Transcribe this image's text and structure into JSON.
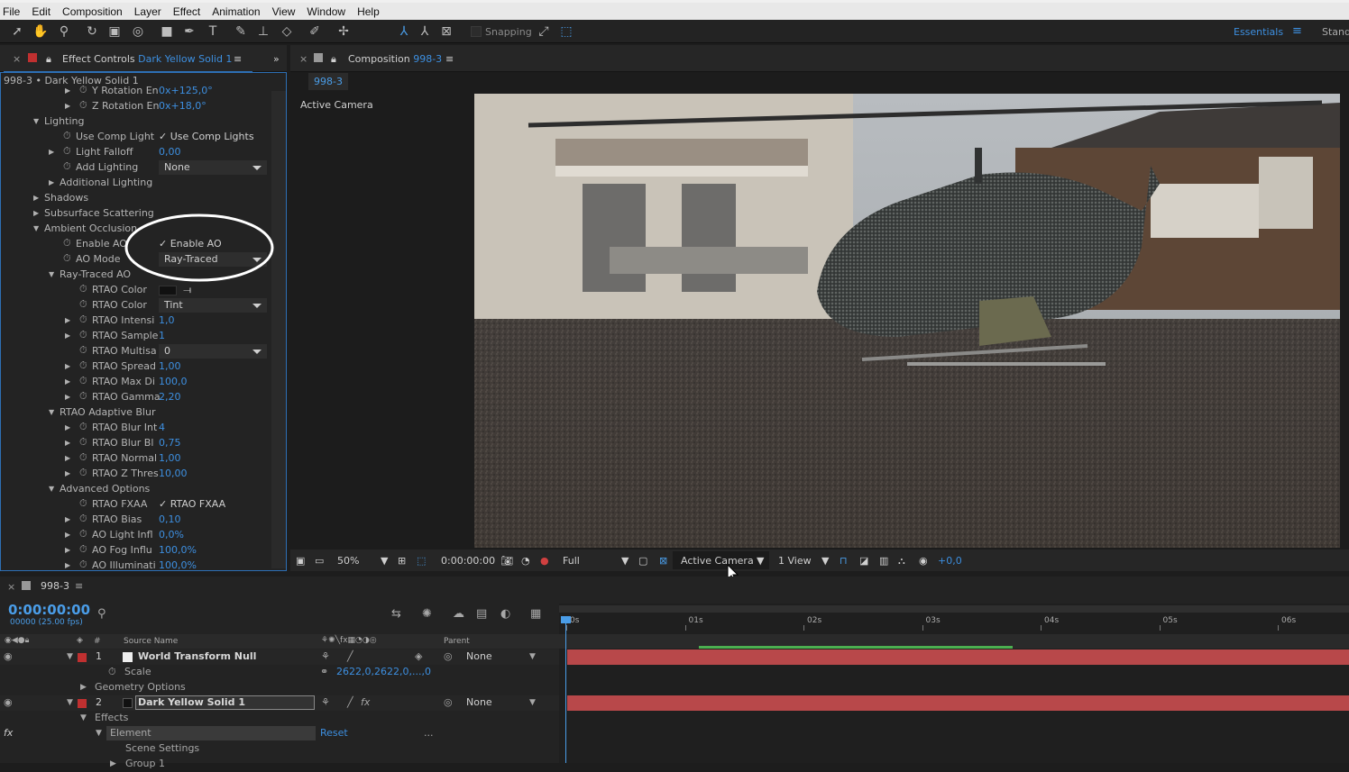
{
  "menu": [
    "File",
    "Edit",
    "Composition",
    "Layer",
    "Effect",
    "Animation",
    "View",
    "Window",
    "Help"
  ],
  "toolbar": {
    "snapping_label": "Snapping",
    "workspace_label": "Essentials",
    "workspace_other": "Stand"
  },
  "effect_panel": {
    "tab_label": "Effect Controls",
    "layer_name": "Dark Yellow Solid 1",
    "breadcrumb": "998-3 • Dark Yellow Solid 1",
    "rows": [
      {
        "indent": 2,
        "tri": "right",
        "sw": true,
        "name": "Y Rotation En",
        "value": "0x+125,0°",
        "type": "blue"
      },
      {
        "indent": 2,
        "tri": "right",
        "sw": true,
        "name": "Z Rotation En",
        "value": "0x+18,0°",
        "type": "blue"
      },
      {
        "indent": 0,
        "tri": "down",
        "sw": false,
        "name": "Lighting",
        "value": "",
        "type": ""
      },
      {
        "indent": 1,
        "tri": "",
        "sw": true,
        "name": "Use Comp Light",
        "value": "Use Comp Lights",
        "type": "check"
      },
      {
        "indent": 1,
        "tri": "right",
        "sw": true,
        "name": "Light Falloff",
        "value": "0,00",
        "type": "blue"
      },
      {
        "indent": 1,
        "tri": "",
        "sw": true,
        "name": "Add Lighting",
        "value": "None",
        "type": "dropdown"
      },
      {
        "indent": 1,
        "tri": "right",
        "sw": false,
        "name": "Additional Lighting",
        "value": "",
        "type": ""
      },
      {
        "indent": 0,
        "tri": "right",
        "sw": false,
        "name": "Shadows",
        "value": "",
        "type": ""
      },
      {
        "indent": 0,
        "tri": "right",
        "sw": false,
        "name": "Subsurface Scattering",
        "value": "",
        "type": ""
      },
      {
        "indent": 0,
        "tri": "down",
        "sw": false,
        "name": "Ambient Occlusion",
        "value": "",
        "type": ""
      },
      {
        "indent": 1,
        "tri": "",
        "sw": true,
        "name": "Enable AO",
        "value": "Enable AO",
        "type": "check"
      },
      {
        "indent": 1,
        "tri": "",
        "sw": true,
        "name": "AO Mode",
        "value": "Ray-Traced",
        "type": "dropdown"
      },
      {
        "indent": 1,
        "tri": "down",
        "sw": false,
        "name": "Ray-Traced AO",
        "value": "",
        "type": ""
      },
      {
        "indent": 2,
        "tri": "",
        "sw": true,
        "name": "RTAO Color",
        "value": "",
        "type": "color"
      },
      {
        "indent": 2,
        "tri": "",
        "sw": true,
        "name": "RTAO Color",
        "value": "Tint",
        "type": "dropdown"
      },
      {
        "indent": 2,
        "tri": "right",
        "sw": true,
        "name": "RTAO Intensi",
        "value": "1,0",
        "type": "blue"
      },
      {
        "indent": 2,
        "tri": "right",
        "sw": true,
        "name": "RTAO Sample",
        "value": "1",
        "type": "blue"
      },
      {
        "indent": 2,
        "tri": "",
        "sw": true,
        "name": "RTAO Multisa",
        "value": "0",
        "type": "dropdown"
      },
      {
        "indent": 2,
        "tri": "right",
        "sw": true,
        "name": "RTAO Spread",
        "value": "1,00",
        "type": "blue"
      },
      {
        "indent": 2,
        "tri": "right",
        "sw": true,
        "name": "RTAO Max Di",
        "value": "100,0",
        "type": "blue"
      },
      {
        "indent": 2,
        "tri": "right",
        "sw": true,
        "name": "RTAO Gamma",
        "value": "2,20",
        "type": "blue"
      },
      {
        "indent": 1,
        "tri": "down",
        "sw": false,
        "name": "RTAO Adaptive Blur",
        "value": "",
        "type": ""
      },
      {
        "indent": 2,
        "tri": "right",
        "sw": true,
        "name": "RTAO Blur Int",
        "value": "4",
        "type": "blue"
      },
      {
        "indent": 2,
        "tri": "right",
        "sw": true,
        "name": "RTAO Blur Bl",
        "value": "0,75",
        "type": "blue"
      },
      {
        "indent": 2,
        "tri": "right",
        "sw": true,
        "name": "RTAO Normal",
        "value": "1,00",
        "type": "blue"
      },
      {
        "indent": 2,
        "tri": "right",
        "sw": true,
        "name": "RTAO Z Thres",
        "value": "10,00",
        "type": "blue"
      },
      {
        "indent": 1,
        "tri": "down",
        "sw": false,
        "name": "Advanced Options",
        "value": "",
        "type": ""
      },
      {
        "indent": 2,
        "tri": "",
        "sw": true,
        "name": "RTAO FXAA",
        "value": "RTAO FXAA",
        "type": "check"
      },
      {
        "indent": 2,
        "tri": "right",
        "sw": true,
        "name": "RTAO Bias",
        "value": "0,10",
        "type": "blue"
      },
      {
        "indent": 2,
        "tri": "right",
        "sw": true,
        "name": "AO Light Infl",
        "value": "0,0%",
        "type": "blue"
      },
      {
        "indent": 2,
        "tri": "right",
        "sw": true,
        "name": "AO Fog Influ",
        "value": "100,0%",
        "type": "blue"
      },
      {
        "indent": 2,
        "tri": "right",
        "sw": true,
        "name": "AO Illuminati",
        "value": "100,0%",
        "type": "blue"
      }
    ]
  },
  "composition": {
    "tab_label": "Composition",
    "comp_name": "998-3",
    "subtab": "998-3",
    "view_label": "Active Camera",
    "bottom": {
      "zoom": "50%",
      "timecode": "0:00:00:00",
      "resolution": "Full",
      "camera": "Active Camera",
      "views": "1 View",
      "exposure": "+0,0"
    }
  },
  "timeline": {
    "tab_label": "998-3",
    "timecode": "0:00:00:00",
    "frame_info": "00000 (25.00 fps)",
    "col_hash": "#",
    "col_source": "Source Name",
    "col_parent": "Parent",
    "ruler": [
      "0s",
      "01s",
      "02s",
      "03s",
      "04s",
      "05s",
      "06s"
    ],
    "layers": [
      {
        "num": "1",
        "name": "World Transform Null",
        "parent": "None"
      },
      {
        "num": "2",
        "name": "Dark Yellow Solid 1",
        "parent": "None"
      }
    ],
    "scale_label": "Scale",
    "scale_value": "2622,0,2622,0,...,0",
    "geometry_label": "Geometry Options",
    "effects_label": "Effects",
    "element_label": "Element",
    "reset_label": "Reset",
    "dots": "...",
    "scene_settings": "Scene Settings",
    "group_label": "Group 1"
  }
}
